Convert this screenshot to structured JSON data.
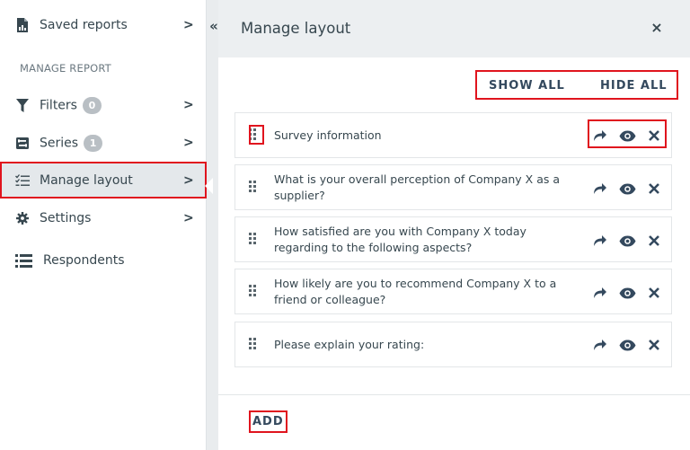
{
  "sidebar": {
    "section_label": "MANAGE REPORT",
    "items": [
      {
        "label": "Saved reports",
        "icon": "document-icon",
        "chevron": ">"
      },
      {
        "label": "Filters",
        "icon": "filter-icon",
        "badge": "0",
        "chevron": ">"
      },
      {
        "label": "Series",
        "icon": "series-icon",
        "badge": "1",
        "chevron": ">"
      },
      {
        "label": "Manage layout",
        "icon": "layout-list-icon",
        "chevron": ">",
        "active": true
      },
      {
        "label": "Settings",
        "icon": "gear-icon",
        "chevron": ">"
      },
      {
        "label": "Respondents",
        "icon": "respondents-list-icon"
      }
    ],
    "collapse_glyph": "«"
  },
  "panel": {
    "title": "Manage layout",
    "close_glyph": "×",
    "show_all": "SHOW ALL",
    "hide_all": "HIDE ALL",
    "rows": [
      {
        "text": "Survey information"
      },
      {
        "text": "What is your overall perception of Company X as a supplier?"
      },
      {
        "text": "How satisfied are you with Company X today regarding to the following aspects?"
      },
      {
        "text": "How likely are you to recommend Company X to a friend or colleague?"
      },
      {
        "text": "Please explain your rating:"
      }
    ],
    "add_label": "ADD"
  },
  "colors": {
    "highlight": "#e0141e",
    "text": "#37474f",
    "header_bg": "#eceff1",
    "badge_bg": "#b9bfc4"
  }
}
